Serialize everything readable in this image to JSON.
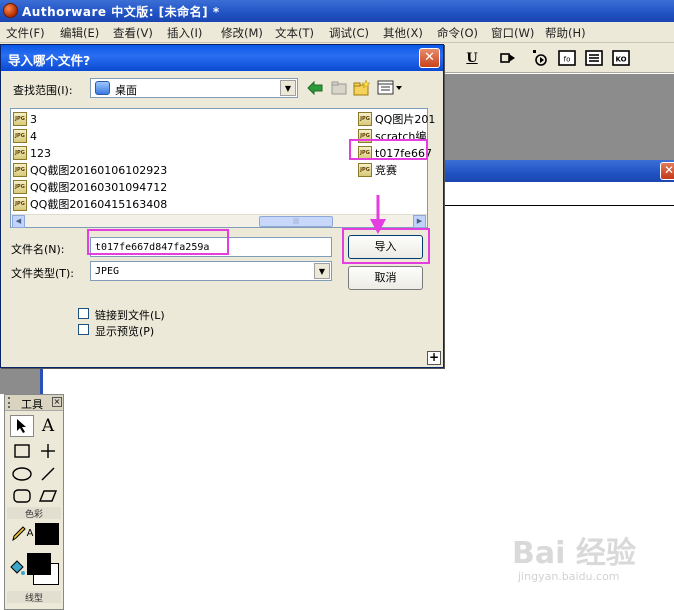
{
  "app": {
    "title": "Authorware 中文版: [未命名] *"
  },
  "menu": [
    "文件(F)",
    "编辑(E)",
    "查看(V)",
    "插入(I)",
    "修改(M)",
    "文本(T)",
    "调试(C)",
    "其他(X)",
    "命令(O)",
    "窗口(W)",
    "帮助(H)"
  ],
  "toolbar": {
    "icons": [
      "underline-icon",
      "play-icon",
      "control-icon",
      "function-icon",
      "variables-icon",
      "knowledge-object-icon"
    ],
    "underline_label": "U",
    "fo_label": "fo",
    "ko_label": "KO"
  },
  "dialog": {
    "title": "导入哪个文件?",
    "close_label": "✕",
    "look_in_label": "查找范围(I):",
    "look_in_value": "桌面",
    "files": [
      {
        "name": "3",
        "col": 0,
        "row": 0
      },
      {
        "name": "4",
        "col": 0,
        "row": 1
      },
      {
        "name": "123",
        "col": 0,
        "row": 2
      },
      {
        "name": "QQ截图20160106102923",
        "col": 0,
        "row": 3
      },
      {
        "name": "QQ截图20160301094712",
        "col": 0,
        "row": 4
      },
      {
        "name": "QQ截图20160415163408",
        "col": 0,
        "row": 5
      },
      {
        "name": "QQ图片201",
        "col": 1,
        "row": 0
      },
      {
        "name": "scratch编",
        "col": 1,
        "row": 1
      },
      {
        "name": "t017fe667",
        "col": 1,
        "row": 2
      },
      {
        "name": "竞赛",
        "col": 1,
        "row": 3
      }
    ],
    "file_icon_text": "JPG",
    "selected_file": "t017fe667",
    "scroll_grip": "|||",
    "filename_label": "文件名(N):",
    "filename_value": "t017fe667d847fa259a",
    "filetype_label": "文件类型(T):",
    "filetype_value": "JPEG",
    "import_button": "导入",
    "cancel_button": "取消",
    "link_to_file_label": "链接到文件(L)",
    "show_preview_label": "显示预览(P)",
    "link_checked": false,
    "preview_checked": false,
    "expand_label": "+"
  },
  "tools_palette": {
    "title": "工具",
    "tools": [
      "pointer-icon",
      "text-tool-icon",
      "rectangle-icon",
      "line-icon",
      "ellipse-icon",
      "diagonal-line-icon",
      "rounded-rect-icon",
      "polygon-icon"
    ],
    "text_tool_label": "A",
    "color_section": "色彩",
    "line_section": "线型",
    "pen_color_label": "A"
  },
  "watermark": {
    "text": "Bai 经验",
    "sub": "jingyan.baidu.com"
  },
  "colors": {
    "highlight": "#e43de0",
    "titlebar": "#2152c4",
    "dialog_bg": "#ece9d8"
  }
}
